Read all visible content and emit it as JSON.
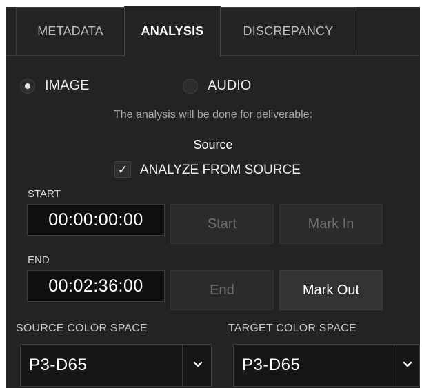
{
  "tabs": [
    {
      "label": "METADATA"
    },
    {
      "label": "ANALYSIS"
    },
    {
      "label": "DISCREPANCY"
    }
  ],
  "active_tab": "ANALYSIS",
  "analysis_type": {
    "options": [
      {
        "label": "IMAGE",
        "selected": true
      },
      {
        "label": "AUDIO",
        "selected": false
      }
    ]
  },
  "deliverable": {
    "info_text": "The analysis will be done for deliverable:",
    "name": "Source"
  },
  "analyze_from_source": {
    "label": "ANALYZE FROM SOURCE",
    "checked": true,
    "check_glyph": "✓"
  },
  "start": {
    "label": "START",
    "timecode": "00:00:00:00",
    "goto_button": "Start",
    "mark_button": "Mark In"
  },
  "end": {
    "label": "END",
    "timecode": "00:02:36:00",
    "goto_button": "End",
    "mark_button": "Mark Out"
  },
  "color_space": {
    "source_label": "SOURCE COLOR SPACE",
    "source_value": "P3-D65",
    "target_label": "TARGET COLOR SPACE",
    "target_value": "P3-D65"
  },
  "colors": {
    "panel_bg": "#232323",
    "timecode_bg": "#0f0f0f",
    "text_primary": "#ffffff",
    "text_disabled": "#6f6f6f"
  }
}
